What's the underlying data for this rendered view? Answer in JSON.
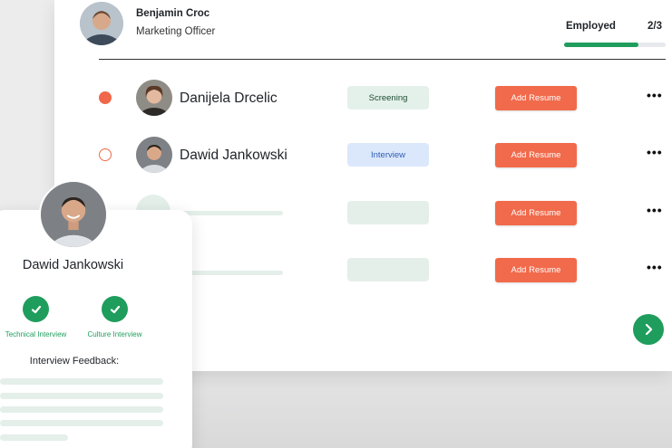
{
  "header": {
    "name": "Benjamin Croc",
    "role": "Marketing Officer",
    "status_label": "Employed",
    "status_count": "2/3",
    "progress_fraction": 0.73
  },
  "candidates": [
    {
      "name": "Danijela Drcelic",
      "stage": "Screening",
      "dot": "filled",
      "action": "Add Resume",
      "menu": "•••"
    },
    {
      "name": "Dawid Jankowski",
      "stage": "Interview",
      "dot": "outline",
      "action": "Add Resume",
      "menu": "•••"
    },
    {
      "name": "",
      "stage": "",
      "dot": "none",
      "action": "Add Resume",
      "menu": "•••"
    },
    {
      "name": "",
      "stage": "",
      "dot": "none",
      "action": "Add Resume",
      "menu": "•••"
    }
  ],
  "profile_card": {
    "name": "Dawid Jankowski",
    "steps": [
      {
        "label": "Technical Interview"
      },
      {
        "label": "Culture Interview"
      }
    ],
    "feedback_title": "Interview Feedback:"
  },
  "icons": {
    "next": "chevron-right-icon",
    "check": "check-icon",
    "menu": "more-horizontal-icon"
  },
  "colors": {
    "accent_green": "#1f9d5c",
    "accent_orange": "#f16a4b",
    "interview_blue": "#2f5fb3"
  }
}
